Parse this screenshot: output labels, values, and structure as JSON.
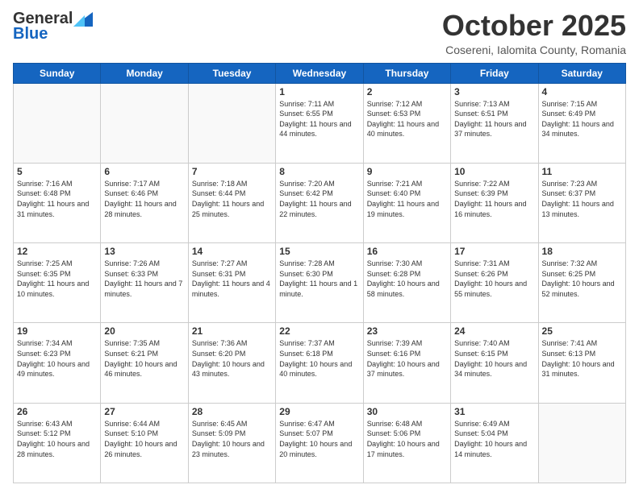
{
  "header": {
    "logo_general": "General",
    "logo_blue": "Blue",
    "title": "October 2025",
    "subtitle": "Cosereni, Ialomita County, Romania"
  },
  "weekdays": [
    "Sunday",
    "Monday",
    "Tuesday",
    "Wednesday",
    "Thursday",
    "Friday",
    "Saturday"
  ],
  "weeks": [
    [
      {
        "day": "",
        "empty": true
      },
      {
        "day": "",
        "empty": true
      },
      {
        "day": "",
        "empty": true
      },
      {
        "day": "1",
        "sunrise": "7:11 AM",
        "sunset": "6:55 PM",
        "daylight": "11 hours and 44 minutes."
      },
      {
        "day": "2",
        "sunrise": "7:12 AM",
        "sunset": "6:53 PM",
        "daylight": "11 hours and 40 minutes."
      },
      {
        "day": "3",
        "sunrise": "7:13 AM",
        "sunset": "6:51 PM",
        "daylight": "11 hours and 37 minutes."
      },
      {
        "day": "4",
        "sunrise": "7:15 AM",
        "sunset": "6:49 PM",
        "daylight": "11 hours and 34 minutes."
      }
    ],
    [
      {
        "day": "5",
        "sunrise": "7:16 AM",
        "sunset": "6:48 PM",
        "daylight": "11 hours and 31 minutes."
      },
      {
        "day": "6",
        "sunrise": "7:17 AM",
        "sunset": "6:46 PM",
        "daylight": "11 hours and 28 minutes."
      },
      {
        "day": "7",
        "sunrise": "7:18 AM",
        "sunset": "6:44 PM",
        "daylight": "11 hours and 25 minutes."
      },
      {
        "day": "8",
        "sunrise": "7:20 AM",
        "sunset": "6:42 PM",
        "daylight": "11 hours and 22 minutes."
      },
      {
        "day": "9",
        "sunrise": "7:21 AM",
        "sunset": "6:40 PM",
        "daylight": "11 hours and 19 minutes."
      },
      {
        "day": "10",
        "sunrise": "7:22 AM",
        "sunset": "6:39 PM",
        "daylight": "11 hours and 16 minutes."
      },
      {
        "day": "11",
        "sunrise": "7:23 AM",
        "sunset": "6:37 PM",
        "daylight": "11 hours and 13 minutes."
      }
    ],
    [
      {
        "day": "12",
        "sunrise": "7:25 AM",
        "sunset": "6:35 PM",
        "daylight": "11 hours and 10 minutes."
      },
      {
        "day": "13",
        "sunrise": "7:26 AM",
        "sunset": "6:33 PM",
        "daylight": "11 hours and 7 minutes."
      },
      {
        "day": "14",
        "sunrise": "7:27 AM",
        "sunset": "6:31 PM",
        "daylight": "11 hours and 4 minutes."
      },
      {
        "day": "15",
        "sunrise": "7:28 AM",
        "sunset": "6:30 PM",
        "daylight": "11 hours and 1 minute."
      },
      {
        "day": "16",
        "sunrise": "7:30 AM",
        "sunset": "6:28 PM",
        "daylight": "10 hours and 58 minutes."
      },
      {
        "day": "17",
        "sunrise": "7:31 AM",
        "sunset": "6:26 PM",
        "daylight": "10 hours and 55 minutes."
      },
      {
        "day": "18",
        "sunrise": "7:32 AM",
        "sunset": "6:25 PM",
        "daylight": "10 hours and 52 minutes."
      }
    ],
    [
      {
        "day": "19",
        "sunrise": "7:34 AM",
        "sunset": "6:23 PM",
        "daylight": "10 hours and 49 minutes."
      },
      {
        "day": "20",
        "sunrise": "7:35 AM",
        "sunset": "6:21 PM",
        "daylight": "10 hours and 46 minutes."
      },
      {
        "day": "21",
        "sunrise": "7:36 AM",
        "sunset": "6:20 PM",
        "daylight": "10 hours and 43 minutes."
      },
      {
        "day": "22",
        "sunrise": "7:37 AM",
        "sunset": "6:18 PM",
        "daylight": "10 hours and 40 minutes."
      },
      {
        "day": "23",
        "sunrise": "7:39 AM",
        "sunset": "6:16 PM",
        "daylight": "10 hours and 37 minutes."
      },
      {
        "day": "24",
        "sunrise": "7:40 AM",
        "sunset": "6:15 PM",
        "daylight": "10 hours and 34 minutes."
      },
      {
        "day": "25",
        "sunrise": "7:41 AM",
        "sunset": "6:13 PM",
        "daylight": "10 hours and 31 minutes."
      }
    ],
    [
      {
        "day": "26",
        "sunrise": "6:43 AM",
        "sunset": "5:12 PM",
        "daylight": "10 hours and 28 minutes."
      },
      {
        "day": "27",
        "sunrise": "6:44 AM",
        "sunset": "5:10 PM",
        "daylight": "10 hours and 26 minutes."
      },
      {
        "day": "28",
        "sunrise": "6:45 AM",
        "sunset": "5:09 PM",
        "daylight": "10 hours and 23 minutes."
      },
      {
        "day": "29",
        "sunrise": "6:47 AM",
        "sunset": "5:07 PM",
        "daylight": "10 hours and 20 minutes."
      },
      {
        "day": "30",
        "sunrise": "6:48 AM",
        "sunset": "5:06 PM",
        "daylight": "10 hours and 17 minutes."
      },
      {
        "day": "31",
        "sunrise": "6:49 AM",
        "sunset": "5:04 PM",
        "daylight": "10 hours and 14 minutes."
      },
      {
        "day": "",
        "empty": true
      }
    ]
  ]
}
